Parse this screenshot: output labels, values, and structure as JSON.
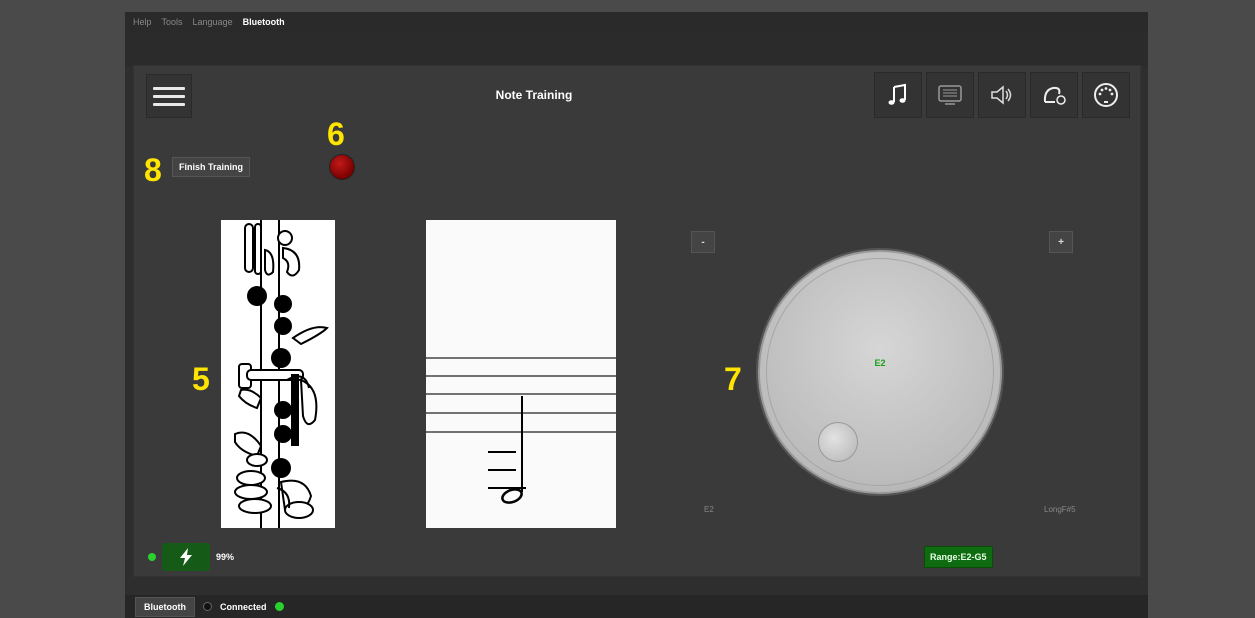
{
  "menu": {
    "items": [
      "Help",
      "Tools",
      "Language",
      "Bluetooth"
    ],
    "active": "Bluetooth"
  },
  "header": {
    "title": "Note Training"
  },
  "toolbar": {
    "icons": [
      "music-note-icon",
      "display-icon",
      "speaker-icon",
      "metronome-icon",
      "midi-connector-icon"
    ]
  },
  "training": {
    "finish_label": "Finish Training",
    "record_indicator_color": "#8b0000"
  },
  "callouts": {
    "c5": "5",
    "c6": "6",
    "c7": "7",
    "c8": "8"
  },
  "dial": {
    "note": "E2",
    "min_label": "E2",
    "max_label": "LongF#5",
    "minus_label": "-",
    "plus_label": "+",
    "range_label": "Range:E2-G5"
  },
  "battery": {
    "percent": "99%",
    "status_color": "#29d12c"
  },
  "statusbar": {
    "tab_label": "Bluetooth",
    "status": "Connected"
  },
  "colors": {
    "note_text": "#18a01a",
    "accent_green": "#0f6b10",
    "callout": "#ffe500"
  }
}
